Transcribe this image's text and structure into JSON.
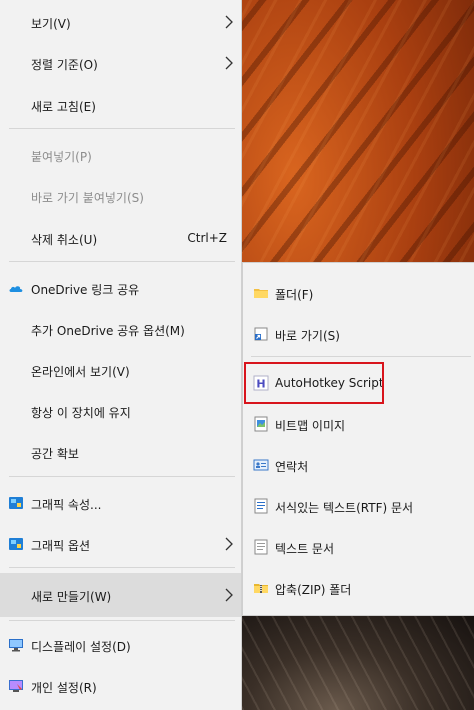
{
  "context_menu": {
    "items": [
      {
        "label": "보기(V)",
        "has_submenu": true
      },
      {
        "label": "정렬 기준(O)",
        "has_submenu": true
      },
      {
        "label": "새로 고침(E)"
      },
      {
        "label": "붙여넣기(P)",
        "disabled": true
      },
      {
        "label": "바로 가기 붙여넣기(S)",
        "disabled": true
      },
      {
        "label": "삭제 취소(U)",
        "shortcut": "Ctrl+Z"
      },
      {
        "label": "OneDrive 링크 공유",
        "icon": "onedrive-cloud-icon"
      },
      {
        "label": "추가 OneDrive 공유 옵션(M)"
      },
      {
        "label": "온라인에서 보기(V)"
      },
      {
        "label": "항상 이 장치에 유지"
      },
      {
        "label": "공간 확보"
      },
      {
        "label": "그래픽 속성...",
        "icon": "graphics-icon"
      },
      {
        "label": "그래픽 옵션",
        "icon": "graphics-icon",
        "has_submenu": true
      },
      {
        "label": "새로 만들기(W)",
        "has_submenu": true,
        "highlighted": true
      },
      {
        "label": "디스플레이 설정(D)",
        "icon": "display-icon"
      },
      {
        "label": "개인 설정(R)",
        "icon": "personalize-icon"
      }
    ]
  },
  "new_submenu": {
    "items": [
      {
        "label": "폴더(F)",
        "icon": "folder-icon"
      },
      {
        "label": "바로 가기(S)",
        "icon": "shortcut-icon"
      },
      {
        "label": "AutoHotkey Script",
        "icon": "autohotkey-icon",
        "marked": true
      },
      {
        "label": "비트맵 이미지",
        "icon": "bitmap-icon"
      },
      {
        "label": "연락처",
        "icon": "contact-icon"
      },
      {
        "label": "서식있는 텍스트(RTF) 문서",
        "icon": "rtf-document-icon"
      },
      {
        "label": "텍스트 문서",
        "icon": "text-document-icon"
      },
      {
        "label": "압축(ZIP) 폴더",
        "icon": "zip-folder-icon"
      }
    ]
  },
  "colors": {
    "menu_bg": "#f2f2f2",
    "hover_bg": "#dcdcdc",
    "disabled_text": "#8d8d8d",
    "annotation_red": "#d8141c"
  }
}
